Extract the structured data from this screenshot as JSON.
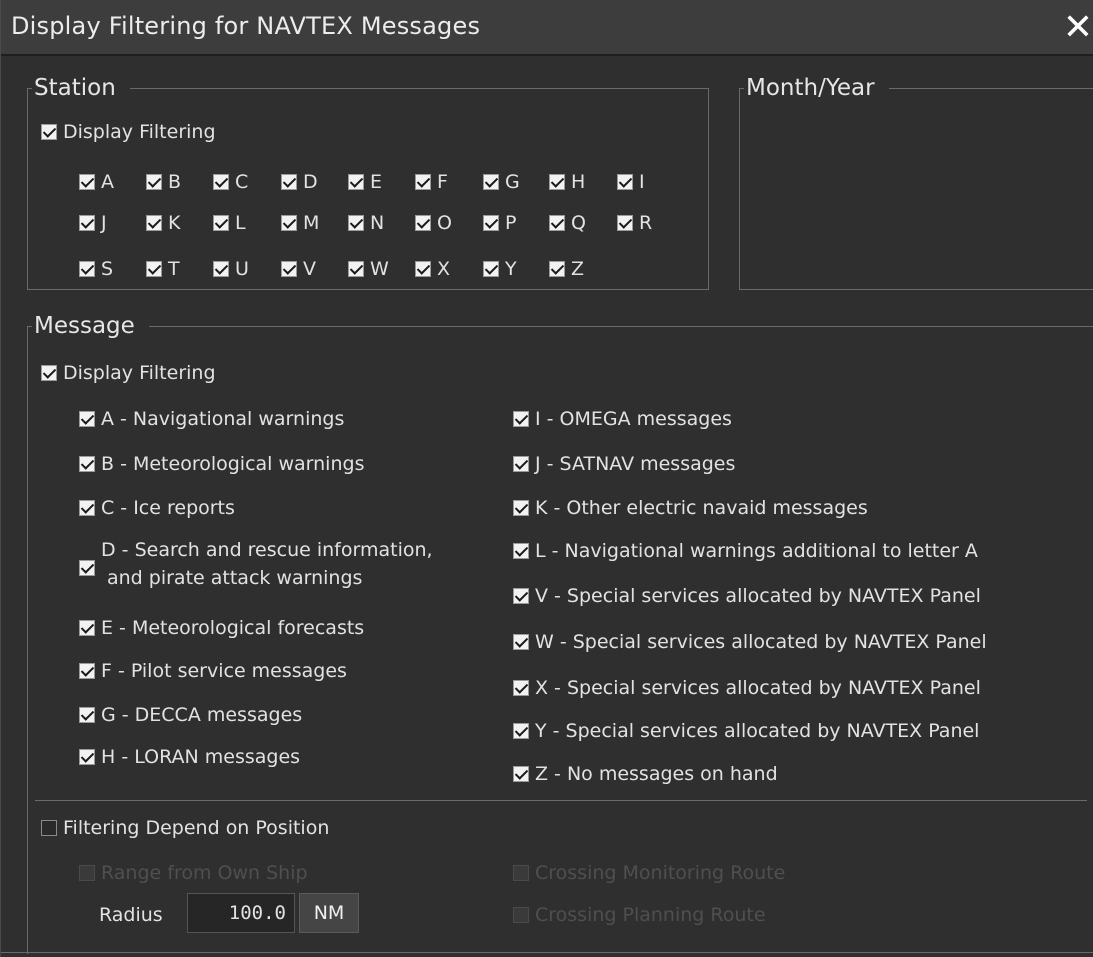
{
  "dialog": {
    "title": "Display Filtering for NAVTEX Messages",
    "close_icon": "close-icon"
  },
  "station": {
    "legend": "Station",
    "display_filtering": {
      "label": "Display Filtering",
      "checked": true
    },
    "letters": [
      "A",
      "B",
      "C",
      "D",
      "E",
      "F",
      "G",
      "H",
      "I",
      "J",
      "K",
      "L",
      "M",
      "N",
      "O",
      "P",
      "Q",
      "R",
      "S",
      "T",
      "U",
      "V",
      "W",
      "X",
      "Y",
      "Z"
    ]
  },
  "month_year": {
    "legend": "Month/Year"
  },
  "message": {
    "legend": "Message",
    "display_filtering": {
      "label": "Display Filtering",
      "checked": true
    },
    "left": [
      "A - Navigational warnings",
      "B - Meteorological warnings",
      "C - Ice reports",
      "D - Search and rescue information,",
      "E - Meteorological forecasts",
      "F - Pilot service messages",
      "G - DECCA messages",
      "H - LORAN messages"
    ],
    "left_d_line2": "and pirate attack warnings",
    "right": [
      "I - OMEGA messages",
      "J - SATNAV messages",
      "K - Other electric navaid messages",
      "L - Navigational warnings additional to letter A",
      "V - Special services allocated by NAVTEX Panel",
      "W - Special services allocated by NAVTEX Panel",
      "X - Special services allocated by NAVTEX Panel",
      "Y - Special services allocated by NAVTEX Panel",
      "Z - No messages on hand"
    ]
  },
  "position": {
    "filtering_depend_on_position": {
      "label": "Filtering Depend on Position",
      "checked": false
    },
    "range_from_own_ship": "Range from Own Ship",
    "crossing_monitoring_route": "Crossing Monitoring Route",
    "crossing_planning_route": "Crossing Planning Route",
    "radius_label": "Radius",
    "radius_value": "100.0",
    "radius_unit": "NM"
  },
  "colors": {
    "background": "#2f2f2f",
    "titlebar": "#3d3d3d",
    "border": "#6a6a6a",
    "disabled_text": "#4f4f4f"
  }
}
